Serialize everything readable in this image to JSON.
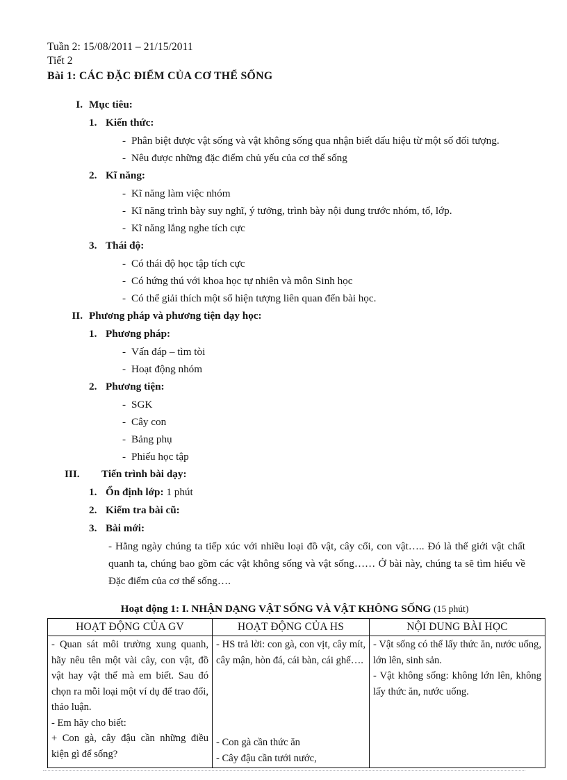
{
  "document": {
    "header": {
      "week_line": "Tuần 2: 15/08/2011 – 21/15/2011",
      "period_line": "Tiết 2",
      "lesson_title": "Bài 1: CÁC ĐẶC ĐIỂM CỦA CƠ THỂ SỐNG"
    },
    "sections": [
      {
        "numeral": "I.",
        "title": "Mục tiêu:",
        "subsections": [
          {
            "marker": "1.",
            "title": "Kiến thức:",
            "items": [
              "Phân biệt được vật sống và vật không sống qua nhận biết dấu hiệu từ một số đối tượng.",
              "Nêu được những đặc điểm chủ yếu của cơ thể sống"
            ]
          },
          {
            "marker": "2.",
            "title": "Kĩ năng:",
            "items": [
              "Kĩ năng làm việc nhóm",
              "Kĩ năng trình bày suy nghĩ, ý tưởng, trình bày nội dung trước nhóm, tổ, lớp.",
              "Kĩ năng lắng nghe tích cực"
            ]
          },
          {
            "marker": "3.",
            "title": "Thái độ:",
            "items": [
              "Có thái độ học tập tích cực",
              "Có hứng thú với khoa học tự nhiên và môn Sinh học",
              "Có thể giải thích một số hiện tượng liên quan đến bài học."
            ]
          }
        ]
      },
      {
        "numeral": "II.",
        "title": "Phương pháp và phương tiện dạy học:",
        "subsections": [
          {
            "marker": "1.",
            "title": "Phương pháp:",
            "items": [
              "Vấn đáp – tìm tòi",
              "Hoạt động nhóm"
            ]
          },
          {
            "marker": "2.",
            "title": "Phương tiện:",
            "items": [
              "SGK",
              "Cây con",
              "Bảng phụ",
              "Phiếu học tập"
            ]
          }
        ]
      },
      {
        "numeral": "III.",
        "title": "Tiến trình bài dạy:",
        "subsections": [
          {
            "marker": "1.",
            "title": "Ổn định lớp:",
            "title_suffix": " 1 phút",
            "items": []
          },
          {
            "marker": "2.",
            "title": "Kiểm tra bài cũ:",
            "items": []
          },
          {
            "marker": "3.",
            "title": "Bài mới:",
            "items": [],
            "paragraph": "- Hằng ngày chúng ta tiếp xúc với nhiều loại đồ vật, cây cối, con vật….. Đó là thế giới vật chất quanh ta, chúng bao gồm các vật không sống và vật sống…… Ở bài này, chúng ta sẽ tìm hiểu về Đặc điểm của cơ thể sống…."
          }
        ]
      }
    ],
    "activity": {
      "caption": "Hoạt động 1: I. NHẬN DẠNG VẬT SỐNG VÀ VẬT KHÔNG SỐNG",
      "duration": "(15 phút)",
      "columns": [
        "HOẠT ĐỘNG CỦA GV",
        "HOẠT ĐỘNG CỦA HS",
        "NỘI DUNG BÀI HỌC"
      ],
      "rows": [
        {
          "gv": [
            "- Quan sát môi trường xung quanh, hãy nêu tên một vài cây, con vật, đồ vật hay vật thể mà em biết. Sau đó chọn ra mỗi loại một ví dụ để trao đổi, thảo luận."
          ],
          "hs": [
            "- HS trả lời: con gà, con vịt, cây mít, cây mận, hòn đá, cái bàn, cái ghế…."
          ],
          "nd": [
            "- Vật sống có thể lấy thức ăn, nước uống, lớn lên, sinh sản.",
            "- Vật không sống: không lớn lên, không lấy thức ăn, nước uống."
          ]
        },
        {
          "gv": [
            "- Em hãy cho biết:",
            "+ Con gà, cây đậu cần những điều kiện gì để sống?"
          ],
          "hs": [
            "- Con gà cần thức ăn",
            "- Cây đậu cần tưới nước,"
          ],
          "nd": []
        }
      ]
    }
  }
}
